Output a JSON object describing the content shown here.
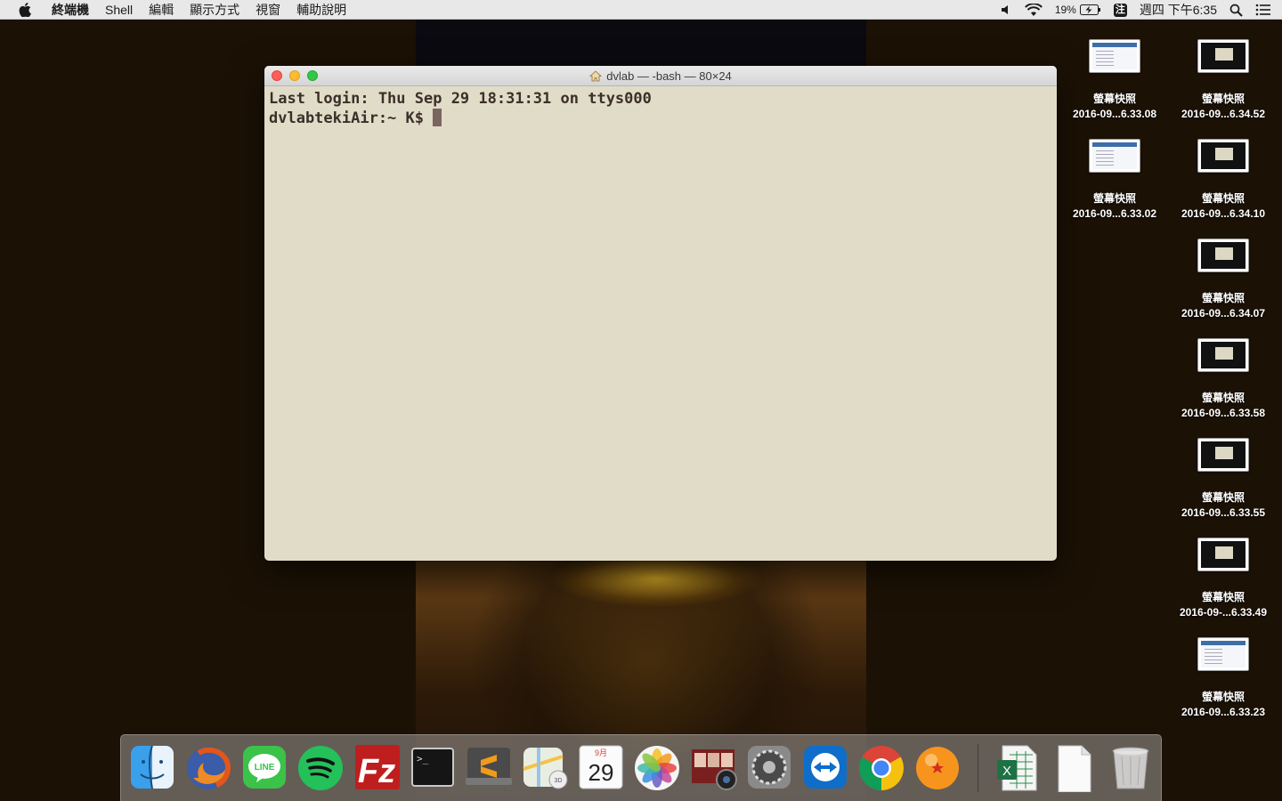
{
  "menubar": {
    "app_name": "終端機",
    "items": [
      "Shell",
      "編輯",
      "顯示方式",
      "視窗",
      "輔助說明"
    ],
    "battery": "19%",
    "input_method": "注",
    "clock": "週四 下午6:35"
  },
  "terminal": {
    "title": "dvlab — -bash — 80×24",
    "lines": [
      "Last login: Thu Sep 29 18:31:31 on ttys000"
    ],
    "prompt": "dvlabtekiAir:~ K$ "
  },
  "desktop_icons": [
    {
      "label": "螢幕快照",
      "sub": "2016-09...6.33.08",
      "style": "light"
    },
    {
      "label": "螢幕快照",
      "sub": "2016-09...6.34.52",
      "style": "dark"
    },
    {
      "label": "螢幕快照",
      "sub": "2016-09...6.33.02",
      "style": "light"
    },
    {
      "label": "螢幕快照",
      "sub": "2016-09...6.34.10",
      "style": "dark"
    },
    {
      "label": "螢幕快照",
      "sub": "2016-09...6.34.07",
      "style": "dark"
    },
    {
      "label": "螢幕快照",
      "sub": "2016-09...6.33.58",
      "style": "dark"
    },
    {
      "label": "螢幕快照",
      "sub": "2016-09...6.33.55",
      "style": "dark"
    },
    {
      "label": "螢幕快照",
      "sub": "2016-09-...6.33.49",
      "style": "dark"
    },
    {
      "label": "螢幕快照",
      "sub": "2016-09...6.33.23",
      "style": "light"
    }
  ],
  "dock": {
    "apps": [
      {
        "name": "finder-icon",
        "running": true
      },
      {
        "name": "firefox-icon",
        "running": true
      },
      {
        "name": "line-icon",
        "running": true
      },
      {
        "name": "spotify-icon",
        "running": true
      },
      {
        "name": "filezilla-icon",
        "running": false
      },
      {
        "name": "terminal-icon",
        "running": true
      },
      {
        "name": "sublime-text-icon",
        "running": false
      },
      {
        "name": "maps-icon",
        "running": false
      },
      {
        "name": "calendar-icon",
        "running": false
      },
      {
        "name": "photos-icon",
        "running": false
      },
      {
        "name": "photo-booth-icon",
        "running": false
      },
      {
        "name": "system-preferences-icon",
        "running": false
      },
      {
        "name": "teamviewer-icon",
        "running": false
      },
      {
        "name": "chrome-icon",
        "running": true
      },
      {
        "name": "dragon-ball-icon",
        "running": false
      }
    ],
    "calendar_month": "9月",
    "calendar_day": "29",
    "docs": [
      {
        "name": "excel-icon"
      },
      {
        "name": "blank-document-icon"
      },
      {
        "name": "trash-icon"
      }
    ]
  },
  "colors": {
    "terminal_bg": "#e1dcc7",
    "terminal_text": "#3b2f2a"
  }
}
